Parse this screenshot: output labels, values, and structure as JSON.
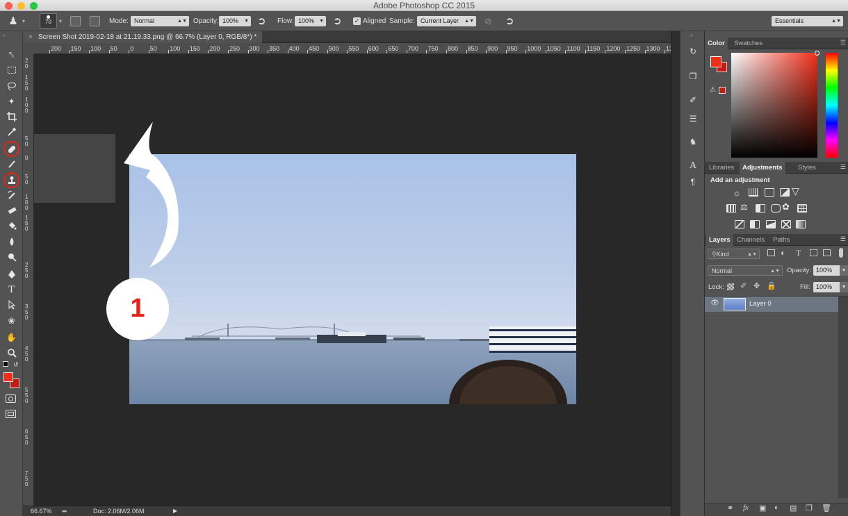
{
  "window": {
    "title": "Adobe Photoshop CC 2015"
  },
  "options": {
    "brush_size": "70",
    "mode_label": "Mode:",
    "mode_value": "Normal",
    "opacity_label": "Opacity:",
    "opacity_value": "100%",
    "flow_label": "Flow:",
    "flow_value": "100%",
    "aligned_label": "Aligned",
    "aligned_checked": true,
    "sample_label": "Sample:",
    "sample_value": "Current Layer",
    "workspace": "Essentials"
  },
  "document": {
    "tab_title": "Screen Shot 2019-02-18 at 21.19.33.png @ 66.7% (Layer 0, RGB/8*) *",
    "ruler_labels": [
      "200",
      "150",
      "100",
      "50",
      "0",
      "50",
      "100",
      "150",
      "200",
      "250",
      "300",
      "350",
      "400",
      "450",
      "500",
      "550",
      "600",
      "650",
      "700",
      "750",
      "800",
      "850",
      "900",
      "950",
      "1000",
      "1050",
      "1100",
      "1150",
      "1200",
      "1250",
      "1300",
      "13"
    ],
    "annotation_number": "1"
  },
  "status": {
    "zoom": "66.67%",
    "doc_size": "Doc: 2.06M/2.06M"
  },
  "color_panel": {
    "tabs": [
      "Color",
      "Swatches"
    ],
    "foreground": "#f02f1a",
    "background": "#c21c12"
  },
  "adjustments_panel": {
    "tabs": [
      "Libraries",
      "Adjustments",
      "Styles"
    ],
    "heading": "Add an adjustment"
  },
  "layers_panel": {
    "tabs": [
      "Layers",
      "Channels",
      "Paths"
    ],
    "filter_kind": "Kind",
    "blend_mode": "Normal",
    "opacity_label": "Opacity:",
    "opacity_value": "100%",
    "lock_label": "Lock:",
    "fill_label": "Fill:",
    "fill_value": "100%",
    "layers": [
      {
        "name": "Layer 0",
        "visible": true,
        "selected": true
      }
    ]
  },
  "icons": [
    "move-icon",
    "marquee-icon",
    "lasso-icon",
    "magic-wand-icon",
    "crop-icon",
    "eyedropper-icon",
    "healing-brush-icon",
    "brush-icon",
    "clone-stamp-icon",
    "history-brush-icon",
    "eraser-icon",
    "paint-bucket-icon",
    "blur-icon",
    "dodge-icon",
    "pen-icon",
    "type-icon",
    "path-select-icon",
    "shape-icon",
    "hand-icon",
    "zoom-icon"
  ]
}
